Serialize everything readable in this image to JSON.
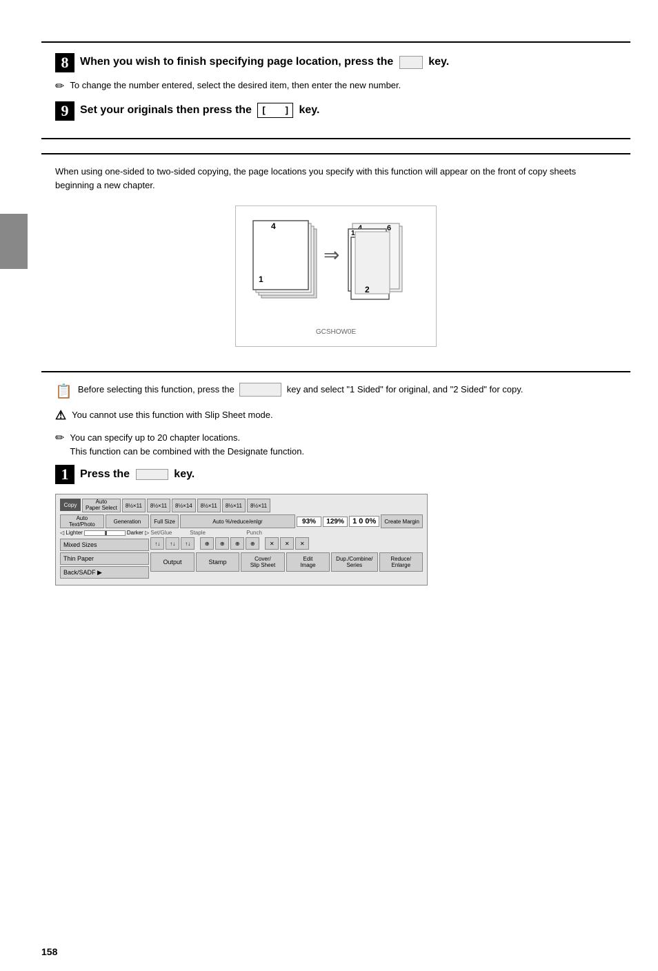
{
  "page": {
    "number": "158"
  },
  "top_section": {
    "step8": {
      "number": "8",
      "text_before": "When you wish to finish specifying page location, press the",
      "key_label": "key.",
      "text_after": ""
    },
    "note": {
      "text": "To change the number entered, select the desired item, then enter the new number."
    },
    "step9": {
      "number": "9",
      "text_before": "Set your originals then press the",
      "bracket_open": "[",
      "bracket_close": "]",
      "key_label": "key."
    }
  },
  "middle_section": {
    "description": "When using one-sided to two-sided copying, the page locations you specify with this function will appear on the front of copy sheets beginning a new chapter.",
    "diagram_label": "GCSHOW0E"
  },
  "notes": [
    {
      "type": "info",
      "icon": "note-book-icon",
      "text": "Before selecting this function, press the                          key and select \"1 Sided\" for original, and \"2 Sided\" for copy."
    },
    {
      "type": "warning",
      "icon": "warning-icon",
      "text": "You cannot use this function with Slip Sheet mode."
    },
    {
      "type": "pencil",
      "icon": "pencil-icon",
      "lines": [
        "You can specify up to 20 chapter locations.",
        "This function can be combined with the Designate function."
      ]
    }
  ],
  "bottom_section": {
    "step1": {
      "number": "1",
      "text_before": "Press the",
      "key_label": "key."
    }
  },
  "copier_panel": {
    "top_buttons": [
      "",
      "Auto Paper Select",
      "8½×11",
      "8½×11",
      "8½×14",
      "8½×11",
      "8½×11",
      "8½×11"
    ],
    "row2": {
      "left": "Auto Text/Photo",
      "options": []
    },
    "row3": {
      "col1": "Full Size",
      "col2": "Auto %/reduce/enlgr",
      "percents": [
        "93%",
        "129%",
        "100%"
      ],
      "col_last": "Create Margin"
    },
    "setglue_label": "Set/Glue",
    "staple_label": "Staple",
    "punch_label": "Punch",
    "icons_row": [
      "↑↓",
      "↑↓",
      "↑↓",
      "⊕|",
      "⊕|",
      "⊕|",
      "⊕|",
      "✕|",
      "✕|",
      "✕|"
    ],
    "slider": {
      "left": "Lighter",
      "right": "Darker"
    },
    "function_buttons": [
      "Output",
      "Stamp",
      "Cover/ Slip Sheet",
      "Edit Image",
      "Dup./Combine/ Series",
      "Reduce/ Enlarge"
    ],
    "left_buttons": [
      "Mixed Sizes",
      "Thin Paper",
      "Back/SADF"
    ]
  }
}
